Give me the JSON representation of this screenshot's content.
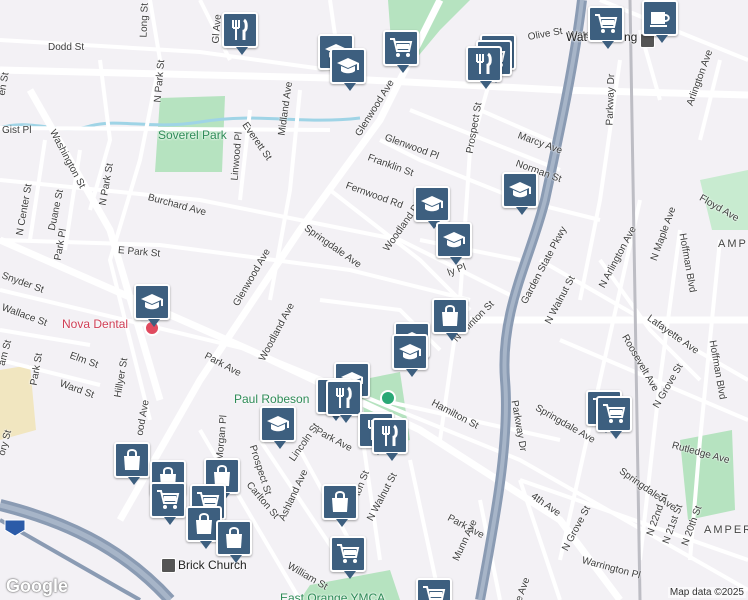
{
  "map": {
    "colors": {
      "background": "#f3f1f5",
      "road": "#ffffff",
      "highway": "#8a9bb3",
      "park": "#b6e3c0",
      "water": "#9fd4e6",
      "pin": "#3d5f7f"
    },
    "streets": {
      "dodd_st": "Dodd St",
      "long_st": "Long St",
      "gist_pl": "Gist Pl",
      "washington_st": "Washington St",
      "n_park_st": "N Park St",
      "everett_st": "Everett St",
      "midland_ave": "Midland Ave",
      "linwood_pl": "Linwood Pl",
      "glenwood_ave_top": "Glenwood Ave",
      "glenwood_ave": "Glenwood Ave",
      "glenwood_pl": "Glenwood Pl",
      "franklin_st": "Franklin St",
      "fernwood_rd": "Fernwood Rd",
      "prospect_st": "Prospect St",
      "marcy_ave": "Marcy Ave",
      "norman_st": "Norman St",
      "olive_st": "Olive St",
      "n_center_st": "N Center St",
      "duane_st": "Duane St",
      "park_pl": "Park Pl",
      "burchard_ave": "Burchard Ave",
      "e_park_st": "E Park St",
      "springdale_ave": "Springdale Ave",
      "woodland_ave": "Woodland Ave",
      "woodland_ave_2": "Woodland Ave",
      "snyder_st": "Snyder St",
      "wallace_st": "Wallace St",
      "elm_st": "Elm St",
      "ward_st": "Ward St",
      "park_st": "Park St",
      "hillyer_st": "Hillyer St",
      "park_ave": "Park Ave",
      "park_ave_2": "Park Ave",
      "park_ave_3": "Park Ave",
      "n_clinton_st": "N Clinton St",
      "hamilton_st": "Hamilton St",
      "garden_state_pkwy": "Garden State Pkwy",
      "parkway_dr": "Parkway Dr",
      "parkway_dr_2": "Parkway Dr",
      "n_walnut_st": "N Walnut St",
      "n_walnut_st_2": "N Walnut St",
      "n_arlington_ave": "N Arlington Ave",
      "arlington_ave": "Arlington Ave",
      "n_maple_ave": "N Maple Ave",
      "hoffman_blvd": "Hoffman Blvd",
      "hoffman_blvd_2": "Hoffman Blvd",
      "floyd_ave": "Floyd Ave",
      "lafayette_ave": "Lafayette Ave",
      "roosevelt_ave": "Roosevelt Ave",
      "springdale_ave_2": "Springdale Ave",
      "springdale_ave_3": "Springdale Ave",
      "n_grove_st": "N Grove St",
      "n_grove_st_2": "N Grove St",
      "rutledge_ave": "Rutledge Ave",
      "fourth_ave": "4th Ave",
      "warrington_pl": "Warrington Pl",
      "n_22nd_st": "N 22nd St",
      "n_21st_st": "N 21st St",
      "n_20th_st": "N 20th St",
      "prospect_st_2": "Prospect St",
      "lincoln_st": "Lincoln St",
      "carlton_st": "Carlton St",
      "ashland_ave": "Ashland Ave",
      "william_st": "William St",
      "munn_ave": "Munn Ave",
      "ton_st": "ton St",
      "n_munn": "n Ave",
      "ory_st": "ory St",
      "am_st": "am St",
      "en_st": "en St",
      "morgan_pl": "Morgan Pl",
      "le_ave": "le Ave",
      "woodland_pl": "Woodland Pl",
      "st_t": "St",
      "ave_b": "Ave",
      "ave_c": "Ave",
      "pl": "Pl",
      "od_ave": "ood Ave",
      "gl_ave": "Gl Ave",
      "be_st": "Be",
      "ly_pl": "ly Pl",
      "watsing_pl": "Wats",
      "le_st": "Ste",
      "ing_pl": "ing Pl"
    },
    "places": {
      "soverel_park": "Soverel Park",
      "nova_dental": "Nova Dental",
      "paul_robeson": "Paul Robeson",
      "paul_robeson_tail": "m",
      "ampere_1": "AMPE",
      "ampere_2": "AMPER",
      "watsessing": "Wat",
      "watsessing_tail": "ng",
      "brick_church": "Brick Church",
      "east_orange_ymca": "East Orange YMCA"
    },
    "highway_shield": "280",
    "attribution": "Map data ©2025",
    "google": "Google"
  }
}
